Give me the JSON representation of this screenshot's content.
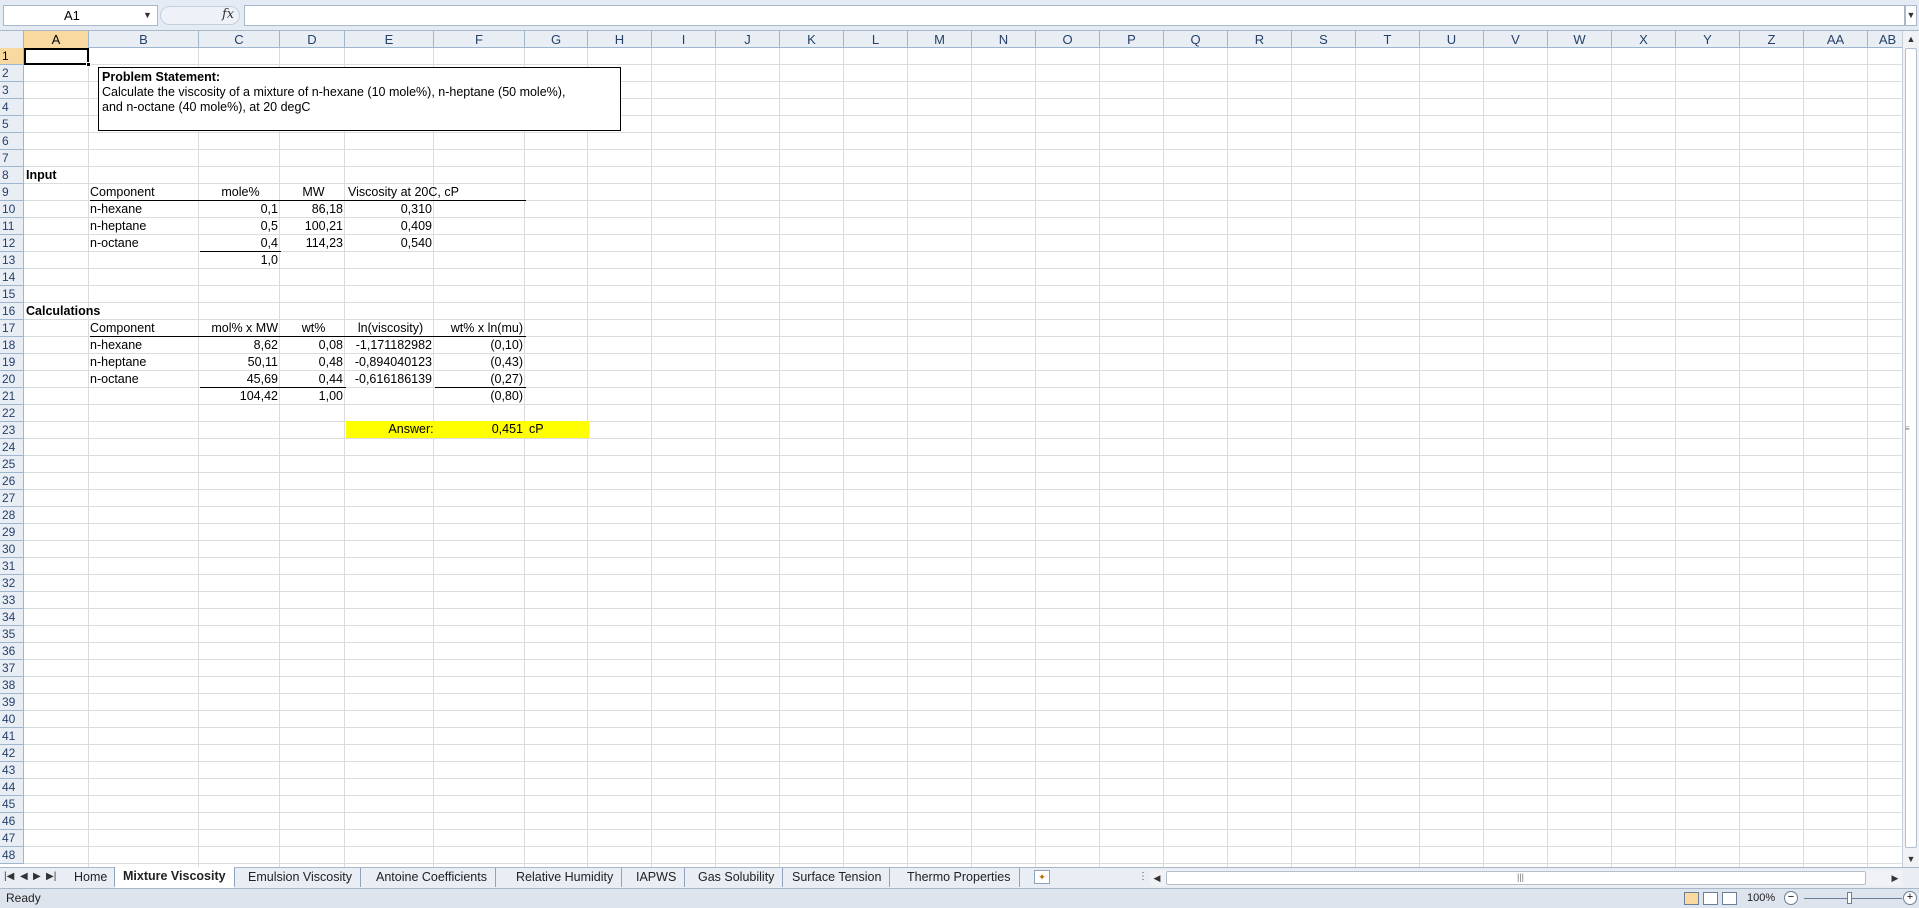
{
  "formula_bar": {
    "name_box": "A1",
    "fx_label": "fx",
    "formula": ""
  },
  "columns": [
    "A",
    "B",
    "C",
    "D",
    "E",
    "F",
    "G",
    "H",
    "I",
    "J",
    "K",
    "L",
    "M",
    "N",
    "O",
    "P",
    "Q",
    "R",
    "S",
    "T",
    "U",
    "V",
    "W",
    "X",
    "Y",
    "Z",
    "AA",
    "AB"
  ],
  "rows": [
    "1",
    "2",
    "3",
    "4",
    "5",
    "6",
    "7",
    "8",
    "9",
    "10",
    "11",
    "12",
    "13",
    "14",
    "15",
    "16",
    "17",
    "18",
    "19",
    "20",
    "21",
    "22",
    "23",
    "24",
    "25",
    "26",
    "27",
    "28",
    "29",
    "30",
    "31",
    "32",
    "33",
    "34",
    "35",
    "36",
    "37",
    "38",
    "39",
    "40",
    "41",
    "42",
    "43",
    "44",
    "45",
    "46",
    "47",
    "48"
  ],
  "problem": {
    "title": "Problem Statement:",
    "line1": "Calculate the viscosity of a mixture of n-hexane (10 mole%), n-heptane (50 mole%),",
    "line2": "and n-octane (40 mole%), at 20 degC"
  },
  "input": {
    "section_label": "Input",
    "headers": {
      "component": "Component",
      "mole": "mole%",
      "mw": "MW",
      "visc": "Viscosity at 20C, cP"
    },
    "rows": [
      {
        "component": "n-hexane",
        "mole": "0,1",
        "mw": "86,18",
        "visc": "0,310"
      },
      {
        "component": "n-heptane",
        "mole": "0,5",
        "mw": "100,21",
        "visc": "0,409"
      },
      {
        "component": "n-octane",
        "mole": "0,4",
        "mw": "114,23",
        "visc": "0,540"
      }
    ],
    "total_mole": "1,0"
  },
  "calculations": {
    "section_label": "Calculations",
    "headers": {
      "component": "Component",
      "molmw": "mol% x MW",
      "wt": "wt%",
      "lnvisc": "ln(viscosity)",
      "wtln": "wt% x ln(mu)"
    },
    "rows": [
      {
        "component": "n-hexane",
        "molmw": "8,62",
        "wt": "0,08",
        "lnvisc": "-1,171182982",
        "wtln": "(0,10)"
      },
      {
        "component": "n-heptane",
        "molmw": "50,11",
        "wt": "0,48",
        "lnvisc": "-0,894040123",
        "wtln": "(0,43)"
      },
      {
        "component": "n-octane",
        "molmw": "45,69",
        "wt": "0,44",
        "lnvisc": "-0,616186139",
        "wtln": "(0,27)"
      }
    ],
    "totals": {
      "molmw": "104,42",
      "wt": "1,00",
      "wtln": "(0,80)"
    }
  },
  "answer": {
    "label": "Answer:",
    "value": "0,451",
    "unit": "cP",
    "highlight": "#ffff00"
  },
  "tabs": [
    {
      "label": "Home"
    },
    {
      "label": "Mixture Viscosity"
    },
    {
      "label": "Emulsion Viscosity"
    },
    {
      "label": "Antoine Coefficients"
    },
    {
      "label": "Relative Humidity"
    },
    {
      "label": "IAPWS"
    },
    {
      "label": "Gas Solubility"
    },
    {
      "label": "Surface Tension"
    },
    {
      "label": "Thermo Properties"
    }
  ],
  "status": {
    "text": "Ready",
    "zoom": "100%"
  },
  "colors": {
    "header_bg": "#e9eef5",
    "gridline": "#dadcdd",
    "selected_header": "#f9d99f"
  }
}
